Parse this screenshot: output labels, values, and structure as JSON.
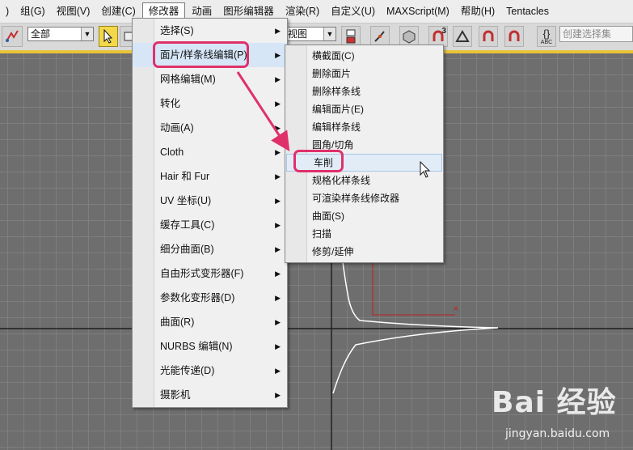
{
  "menubar": {
    "items": [
      ")",
      "组(G)",
      "视图(V)",
      "创建(C)",
      "修改器",
      "动画",
      "图形编辑器",
      "渲染(R)",
      "自定义(U)",
      "MAXScript(M)",
      "帮助(H)",
      "Tentacles"
    ]
  },
  "toolbar": {
    "selection_filter": "全部",
    "view_dropdown": "视图",
    "search_placeholder": "创建选择集",
    "snap_label": "3",
    "selection_label": "ABC"
  },
  "modifier_menu": {
    "items": [
      {
        "label": "选择(S)",
        "submenu": true
      },
      {
        "label": "面片/样条线编辑(P)",
        "submenu": true
      },
      {
        "label": "网格编辑(M)",
        "submenu": true
      },
      {
        "label": "转化",
        "submenu": true
      },
      {
        "label": "动画(A)",
        "submenu": true
      },
      {
        "label": "Cloth",
        "submenu": true
      },
      {
        "label": "Hair 和 Fur",
        "submenu": true
      },
      {
        "label": "UV 坐标(U)",
        "submenu": true
      },
      {
        "label": "缓存工具(C)",
        "submenu": true
      },
      {
        "label": "细分曲面(B)",
        "submenu": true
      },
      {
        "label": "自由形式变形器(F)",
        "submenu": true
      },
      {
        "label": "参数化变形器(D)",
        "submenu": true
      },
      {
        "label": "曲面(R)",
        "submenu": true
      },
      {
        "label": "NURBS 编辑(N)",
        "submenu": true
      },
      {
        "label": "光能传递(D)",
        "submenu": true
      },
      {
        "label": "摄影机",
        "submenu": true
      }
    ]
  },
  "patch_spline_submenu": {
    "items": [
      "横截面(C)",
      "删除面片",
      "删除样条线",
      "编辑面片(E)",
      "编辑样条线",
      "圆角/切角",
      "车削",
      "规格化样条线",
      "可渲染样条线修改器",
      "曲面(S)",
      "扫描",
      "修剪/延伸"
    ],
    "hovered": "车削"
  },
  "watermark": {
    "logo": "Bai 经验",
    "url": "jingyan.baidu.com"
  },
  "colors": {
    "callout": "#e0306a",
    "toolbar_accent": "#e8c43a",
    "viewport_bg": "#6e6e6e"
  }
}
